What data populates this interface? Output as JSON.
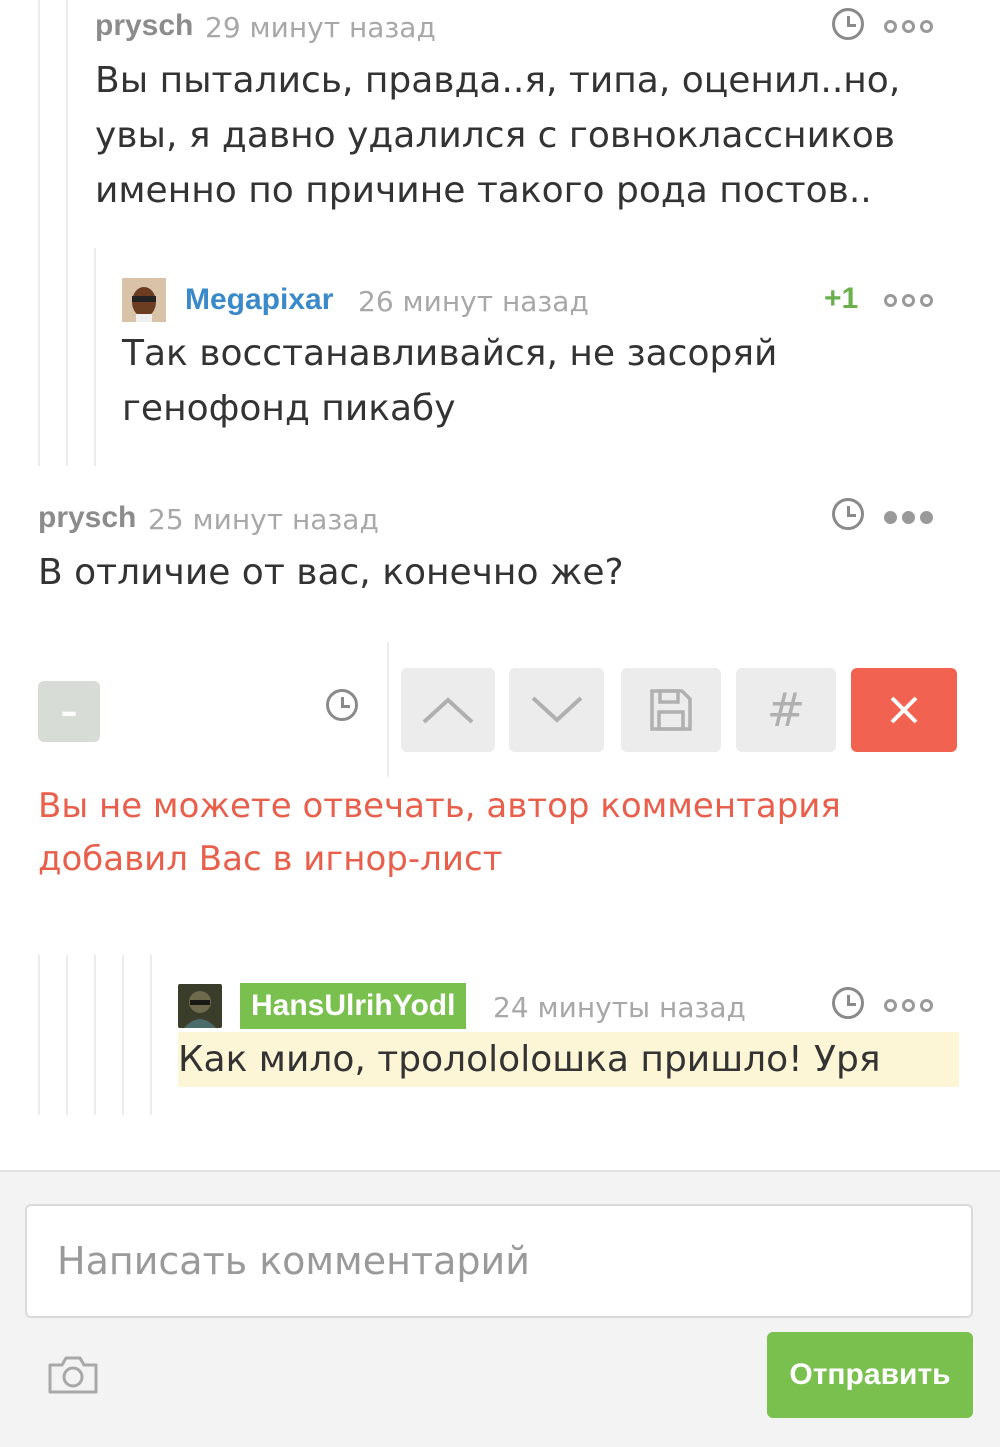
{
  "comments": [
    {
      "author": "prysch",
      "time": "29 минут назад",
      "text_lines": [
        "Вы пытались, правда..я, типа, оценил..но,",
        "увы, я давно удалился с говноклассников",
        "именно по причине такого рода постов.."
      ]
    },
    {
      "author": "Megapixar",
      "time": "26 минут назад",
      "rating": "+1",
      "text_lines": [
        "Так восстанавливайся, не засоряй",
        "генофонд пикабу"
      ]
    },
    {
      "author": "prysch",
      "time": "25 минут назад",
      "text_lines": [
        "В отличие от вас, конечно же?"
      ]
    },
    {
      "author": "HansUlrihYodl",
      "time": "24 минуты назад",
      "text_lines": [
        "Как мило, тролololошка пришло! Уря"
      ]
    }
  ],
  "toolbar": {
    "collapse_label": "–",
    "hash_label": "#",
    "close_label": "✕"
  },
  "warning_lines": [
    "Вы не можете отвечать, автор комментария",
    "добавил Вас в игнор-лист"
  ],
  "reply": {
    "placeholder": "Написать комментарий",
    "send_label": "Отправить"
  },
  "colors": {
    "accent_green": "#79c04f",
    "rating_green": "#6ab04c",
    "author_link": "#3a8ac9",
    "danger": "#f16350",
    "warning_text": "#e8604c",
    "highlight": "#fdf6d6"
  },
  "icons": [
    "clock-icon",
    "more-dots-icon",
    "chevron-up-icon",
    "chevron-down-icon",
    "save-icon",
    "hash-icon",
    "close-icon",
    "camera-icon"
  ]
}
